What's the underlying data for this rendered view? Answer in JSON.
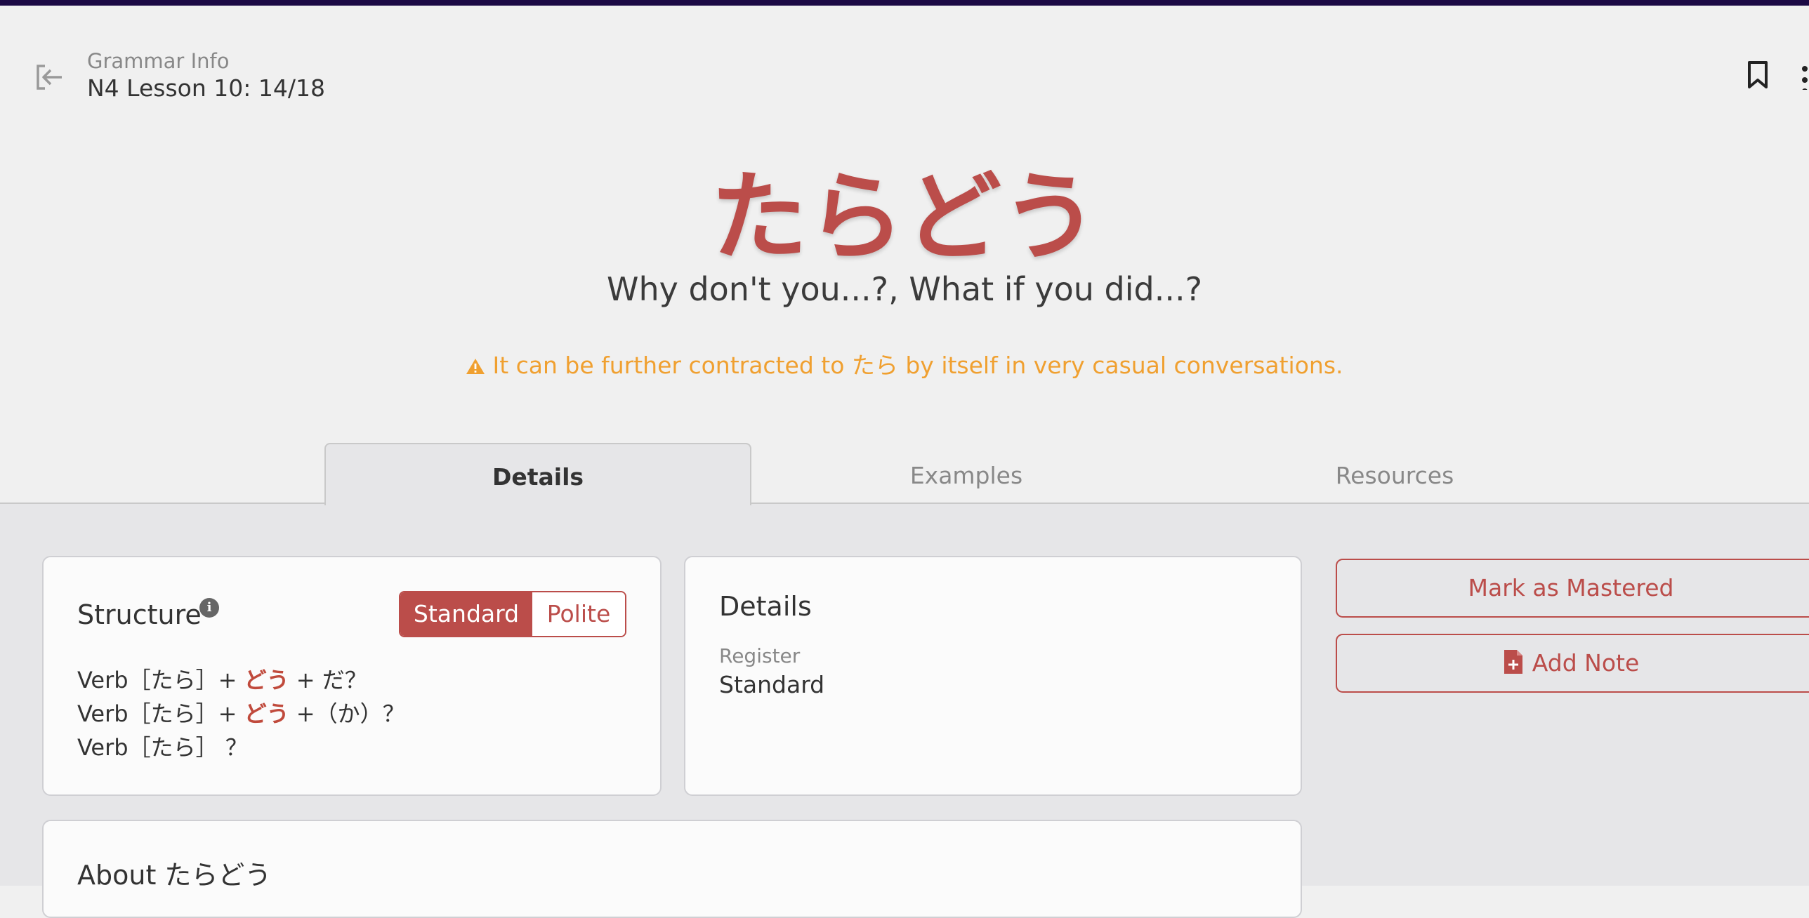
{
  "header": {
    "breadcrumb_label": "Grammar Info",
    "lesson_title": "N4 Lesson 10: 14/18"
  },
  "grammar": {
    "title": "たらどう",
    "meaning": "Why don't you...?, What if you did...?",
    "note": "It can be further contracted to たら by itself in very casual conversations."
  },
  "tabs": [
    {
      "label": "Details",
      "active": true
    },
    {
      "label": "Examples",
      "active": false
    },
    {
      "label": "Resources",
      "active": false
    }
  ],
  "structure": {
    "title": "Structure",
    "toggle": {
      "standard": "Standard",
      "polite": "Polite",
      "selected": "Standard"
    },
    "lines": [
      {
        "pre": "Verb［たら］+ ",
        "hl": "どう",
        "post": " + だ？"
      },
      {
        "pre": "Verb［たら］+ ",
        "hl": "どう",
        "post": " +（か）？"
      },
      {
        "pre": "Verb［たら］ ？",
        "hl": "",
        "post": ""
      }
    ]
  },
  "details": {
    "title": "Details",
    "register_label": "Register",
    "register_value": "Standard"
  },
  "about": {
    "title": "About たらどう"
  },
  "actions": {
    "mastered": "Mark as Mastered",
    "add_note": "Add Note"
  },
  "colors": {
    "accent": "#bb4d4a",
    "warning": "#f0a030",
    "topbar": "#1c0a45"
  },
  "icons": {
    "back": "exit-arrow-icon",
    "bookmark": "bookmark-icon",
    "more": "more-vertical-icon",
    "info": "info-icon",
    "warning": "warning-triangle-icon",
    "note": "document-plus-icon"
  }
}
